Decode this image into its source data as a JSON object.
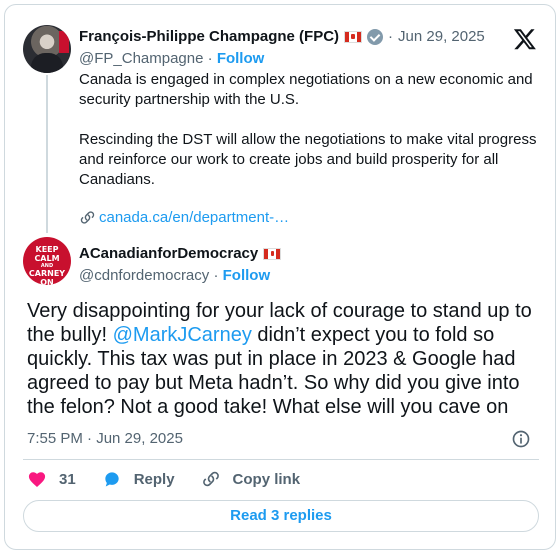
{
  "quoted_tweet": {
    "author_name": "François-Philippe Champagne (FPC)",
    "date": "Jun 29, 2025",
    "handle": "@FP_Champagne",
    "follow_label": "Follow",
    "paragraphs": [
      "Canada is engaged in complex negotiations on a new economic and security partnership with the U.S.",
      "Rescinding the DST will allow the negotiations to make vital progress and reinforce our work to create jobs and build prosperity for all Canadians."
    ],
    "link_text": "canada.ca/en/department-…"
  },
  "reply_tweet": {
    "author_name": "ACanadianforDemocracy",
    "handle": "@cdnfordemocracy",
    "follow_label": "Follow",
    "avatar_text": [
      "KEEP",
      "CALM",
      "AND",
      "CARNEY",
      "ON"
    ],
    "text_before": "Very disappointing for your lack of courage to stand up to the bully! ",
    "mention": "@MarkJCarney",
    "text_after": " didn’t expect you to fold so quickly. This tax was put in place in 2023 & Google had agreed to pay but Meta hadn’t. So why did you give into the felon? Not a good take! What else will you cave on",
    "timestamp": "7:55 PM · Jun 29, 2025"
  },
  "actions": {
    "like_count": "31",
    "reply_label": "Reply",
    "copy_link_label": "Copy link"
  },
  "read_replies_label": "Read 3 replies",
  "separator": "·",
  "colors": {
    "accent": "#1d9bf0",
    "like": "#f91880",
    "muted": "#536471"
  }
}
